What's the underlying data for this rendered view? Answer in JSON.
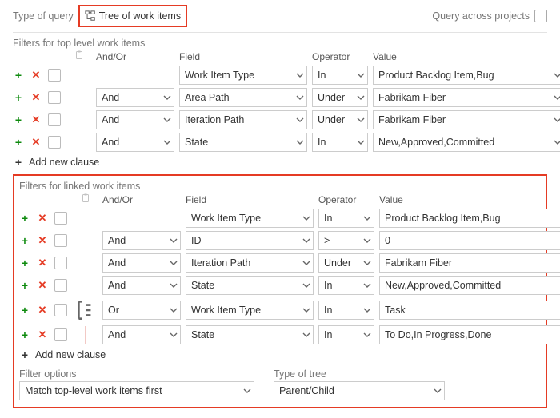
{
  "header": {
    "typeOfQueryLabel": "Type of query",
    "typeOfQueryValue": "Tree of work items",
    "queryAcrossLabel": "Query across projects"
  },
  "sections": {
    "top": {
      "title": "Filters for top level work items",
      "headers": {
        "andor": "And/Or",
        "field": "Field",
        "operator": "Operator",
        "value": "Value"
      },
      "rows": [
        {
          "addVisible": true,
          "andor": "",
          "field": "Work Item Type",
          "operator": "In",
          "value": "Product Backlog Item,Bug"
        },
        {
          "addVisible": true,
          "andor": "And",
          "field": "Area Path",
          "operator": "Under",
          "value": "Fabrikam Fiber"
        },
        {
          "addVisible": true,
          "andor": "And",
          "field": "Iteration Path",
          "operator": "Under",
          "value": "Fabrikam Fiber"
        },
        {
          "addVisible": true,
          "andor": "And",
          "field": "State",
          "operator": "In",
          "value": "New,Approved,Committed"
        }
      ],
      "addNew": "Add new clause"
    },
    "linked": {
      "title": "Filters for linked work items",
      "headers": {
        "andor": "And/Or",
        "field": "Field",
        "operator": "Operator",
        "value": "Value"
      },
      "rows": [
        {
          "group": "",
          "andor": "",
          "field": "Work Item Type",
          "operator": "In",
          "value": "Product Backlog Item,Bug"
        },
        {
          "group": "",
          "andor": "And",
          "field": "ID",
          "operator": ">",
          "value": "0"
        },
        {
          "group": "",
          "andor": "And",
          "field": "Iteration Path",
          "operator": "Under",
          "value": "Fabrikam Fiber"
        },
        {
          "group": "",
          "andor": "And",
          "field": "State",
          "operator": "In",
          "value": "New,Approved,Committed"
        },
        {
          "group": "icon",
          "andor": "Or",
          "field": "Work Item Type",
          "operator": "In",
          "value": "Task"
        },
        {
          "group": "bar",
          "andor": "And",
          "field": "State",
          "operator": "In",
          "value": "To Do,In Progress,Done"
        }
      ],
      "addNew": "Add new clause"
    }
  },
  "bottom": {
    "filterOptionsLabel": "Filter options",
    "filterOptionsValue": "Match top-level work items first",
    "typeOfTreeLabel": "Type of tree",
    "typeOfTreeValue": "Parent/Child"
  }
}
